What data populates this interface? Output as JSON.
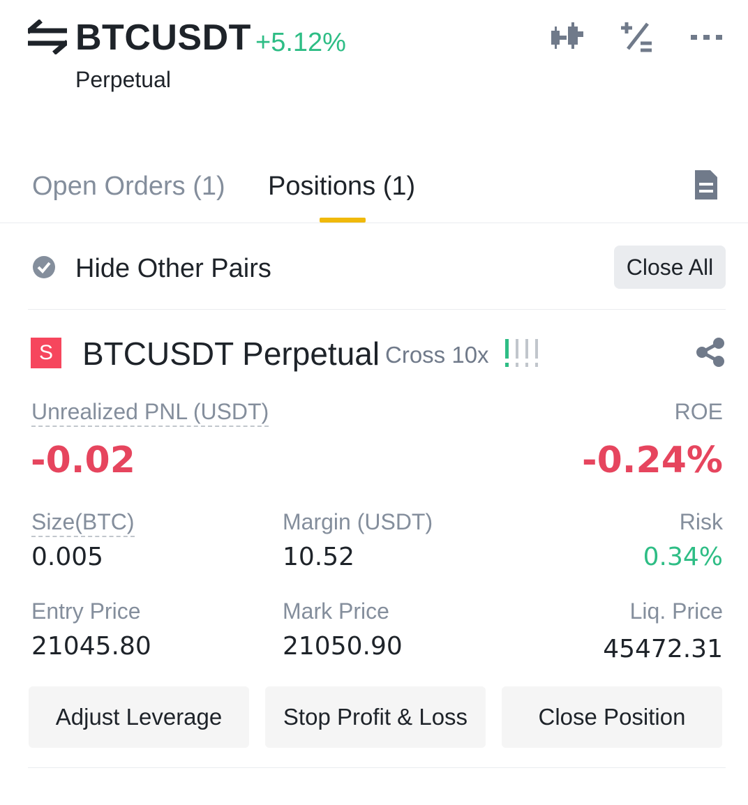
{
  "header": {
    "pair": "BTCUSDT",
    "change": "+5.12%",
    "contract_type": "Perpetual",
    "icons": [
      "swap-icon",
      "candlestick-chart-icon",
      "calculator-icon",
      "more-icon"
    ]
  },
  "tabs": [
    {
      "label": "Open Orders (1)",
      "active": false
    },
    {
      "label": "Positions (1)",
      "active": true
    }
  ],
  "filter": {
    "hide_other_pairs": "Hide Other Pairs",
    "close_all": "Close All"
  },
  "position": {
    "side": "S",
    "symbol": "BTCUSDT Perpetual",
    "margin_mode": "Cross 10x",
    "unrealized_pnl_label": "Unrealized PNL (USDT)",
    "unrealized_pnl": "-0.02",
    "roe_label": "ROE",
    "roe": "-0.24%",
    "size_label": "Size(BTC)",
    "size": "0.005",
    "margin_label": "Margin (USDT)",
    "margin": "10.52",
    "risk_label": "Risk",
    "risk": "0.34%",
    "entry_price_label": "Entry Price",
    "entry_price": "21045.80",
    "mark_price_label": "Mark Price",
    "mark_price": "21050.90",
    "liq_price_label": "Liq. Price",
    "liq_price": "45472.31",
    "risk_level": 1,
    "risk_level_max": 4
  },
  "actions": {
    "adjust_leverage": "Adjust Leverage",
    "stop_profit_loss": "Stop Profit & Loss",
    "close_position": "Close Position"
  },
  "colors": {
    "positive": "#2ebd85",
    "negative": "#e6455e",
    "accent": "#f0b90b",
    "muted": "#848e9c"
  }
}
